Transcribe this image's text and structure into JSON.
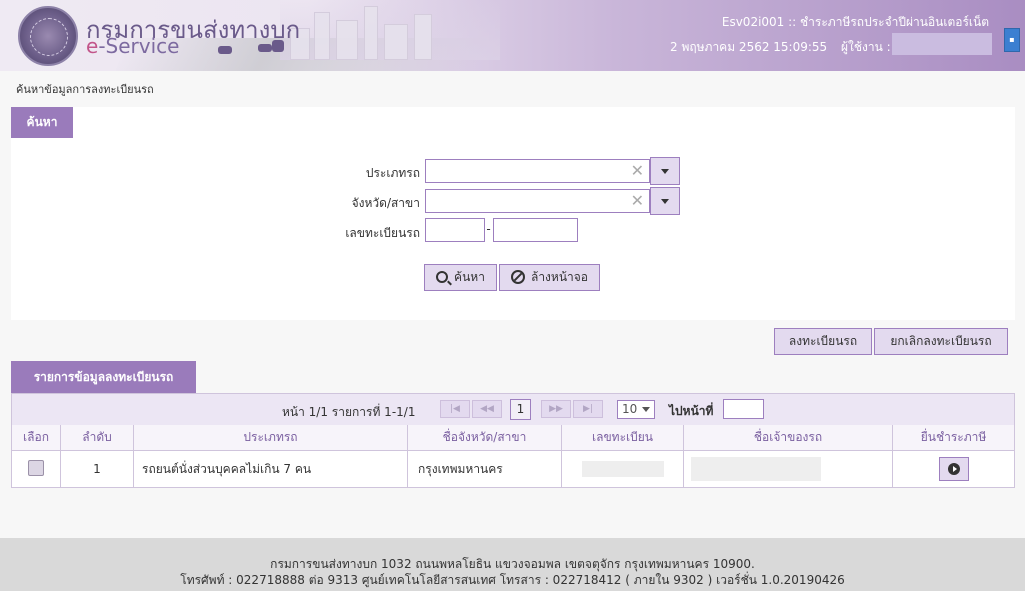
{
  "header": {
    "org_name": "กรมการขนส่งทางบก",
    "service_prefix": "e",
    "service_name": "-Service",
    "page_code_title": "Esv02i001 :: ชำระภาษีรถประจำปีผ่านอินเตอร์เน็ต",
    "datetime": "2 พฤษภาคม 2562 15:09:55",
    "user_label": "ผู้ใช้งาน :",
    "user_value": ""
  },
  "breadcrumb": "ค้นหาข้อมูลการลงทะเบียนรถ",
  "search": {
    "tab_label": "ค้นหา",
    "vehicle_type_label": "ประเภทรถ",
    "vehicle_type_value": "",
    "province_label": "จังหวัด/สาขา",
    "province_value": "",
    "plate_label": "เลขทะเบียนรถ",
    "plate_part1": "",
    "plate_part2": "",
    "plate_separator": "-",
    "search_button": "ค้นหา",
    "clear_button": "ล้างหน้าจอ"
  },
  "actions": {
    "register_button": "ลงทะเบียนรถ",
    "unregister_button": "ยกเลิกลงทะเบียนรถ"
  },
  "list": {
    "tab_label": "รายการข้อมูลลงทะเบียนรถ",
    "pager_text": "หน้า 1/1 รายการที่ 1-1/1",
    "current_page": "1",
    "page_size": "10",
    "goto_label": "ไปหน้าที่",
    "columns": [
      "เลือก",
      "ลำดับ",
      "ประเภทรถ",
      "ชื่อจังหวัด/สาขา",
      "เลขทะเบียน",
      "ชื่อเจ้าของรถ",
      "ยื่นชำระภาษี"
    ],
    "rows": [
      {
        "no": "1",
        "vehicle_type": "รถยนต์นั่งส่วนบุคคลไม่เกิน 7 คน",
        "province": "กรุงเทพมหานคร",
        "plate": "",
        "owner": ""
      }
    ]
  },
  "footer": {
    "line1": "กรมการขนส่งทางบก 1032 ถนนพหลโยธิน แขวงจอมพล เขตจตุจักร กรุงเทพมหานคร 10900.",
    "line2": "โทรศัพท์ : 022718888 ต่อ 9313 ศูนย์เทคโนโลยีสารสนเทศ โทรสาร : 022718412 ( ภายใน 9302 ) เวอร์ชั่น 1.0.20190426"
  },
  "colors": {
    "header_accent": "#a98dc2",
    "tab_purple": "#9a7bbb",
    "button_fill": "#e3daef",
    "border_purple": "#9d7fbf",
    "footer_gray": "#d9d9d9"
  },
  "icons": {
    "logo": "department-seal-icon",
    "search_button": "magnifier-icon",
    "clear_button": "ban-icon",
    "pay_button": "play-circle-icon",
    "menu": "menu-toggle-icon"
  }
}
